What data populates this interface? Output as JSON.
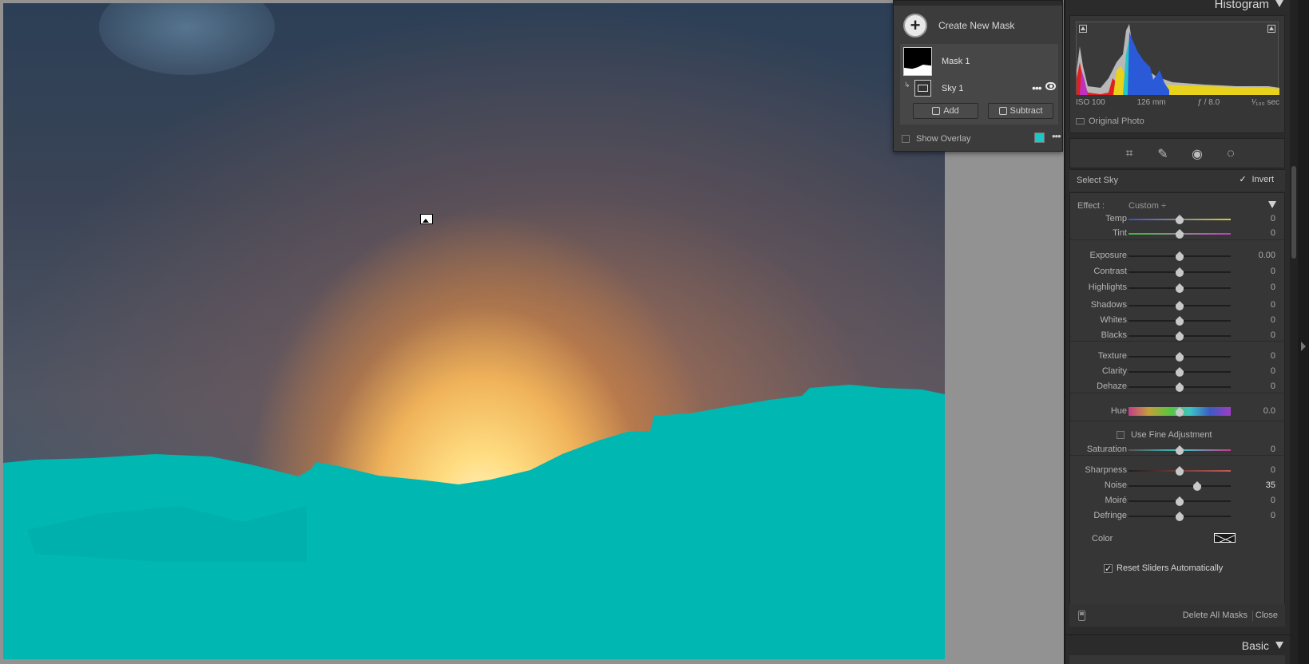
{
  "masks_panel": {
    "create_new_mask": "Create New Mask",
    "create_icon": "+",
    "mask1_label": "Mask 1",
    "sky1_label": "Sky 1",
    "more_icon": "•••",
    "add_label": "Add",
    "subtract_label": "Subtract",
    "show_overlay_label": "Show Overlay",
    "overlay_color": "#1ec6c6"
  },
  "histogram": {
    "title": "Histogram",
    "exif": {
      "iso": "ISO 100",
      "focal": "126 mm",
      "aperture": "ƒ / 8.0",
      "shutter": "¹⁄₁₀₀ sec"
    },
    "original_photo": "Original Photo"
  },
  "tools": [
    "crop-icon",
    "healing-icon",
    "red-eye-icon",
    "masking-icon"
  ],
  "mask_settings": {
    "select_label": "Select Sky",
    "invert_label": "Invert",
    "invert_checked": true,
    "effect_label": "Effect :",
    "effect_value": "Custom ÷",
    "fine_adjustment_label": "Use Fine Adjustment",
    "color_label": "Color",
    "reset_label": "Reset Sliders Automatically",
    "sliders": [
      {
        "label": "Temp",
        "value": "0",
        "pos": 0.5
      },
      {
        "label": "Tint",
        "value": "0",
        "pos": 0.5
      },
      {
        "label": "Exposure",
        "value": "0.00",
        "pos": 0.5
      },
      {
        "label": "Contrast",
        "value": "0",
        "pos": 0.5
      },
      {
        "label": "Highlights",
        "value": "0",
        "pos": 0.5
      },
      {
        "label": "Shadows",
        "value": "0",
        "pos": 0.5
      },
      {
        "label": "Whites",
        "value": "0",
        "pos": 0.5
      },
      {
        "label": "Blacks",
        "value": "0",
        "pos": 0.5
      },
      {
        "label": "Texture",
        "value": "0",
        "pos": 0.5
      },
      {
        "label": "Clarity",
        "value": "0",
        "pos": 0.5
      },
      {
        "label": "Dehaze",
        "value": "0",
        "pos": 0.5
      },
      {
        "label": "Hue",
        "value": "0.0",
        "pos": 0.5
      },
      {
        "label": "Saturation",
        "value": "0",
        "pos": 0.5
      },
      {
        "label": "Sharpness",
        "value": "0",
        "pos": 0.5
      },
      {
        "label": "Noise",
        "value": "35",
        "pos": 0.67
      },
      {
        "label": "Moiré",
        "value": "0",
        "pos": 0.5
      },
      {
        "label": "Defringe",
        "value": "0",
        "pos": 0.5
      }
    ],
    "delete_all_label": "Delete All Masks",
    "close_label": "Close"
  },
  "basic": {
    "title": "Basic"
  }
}
